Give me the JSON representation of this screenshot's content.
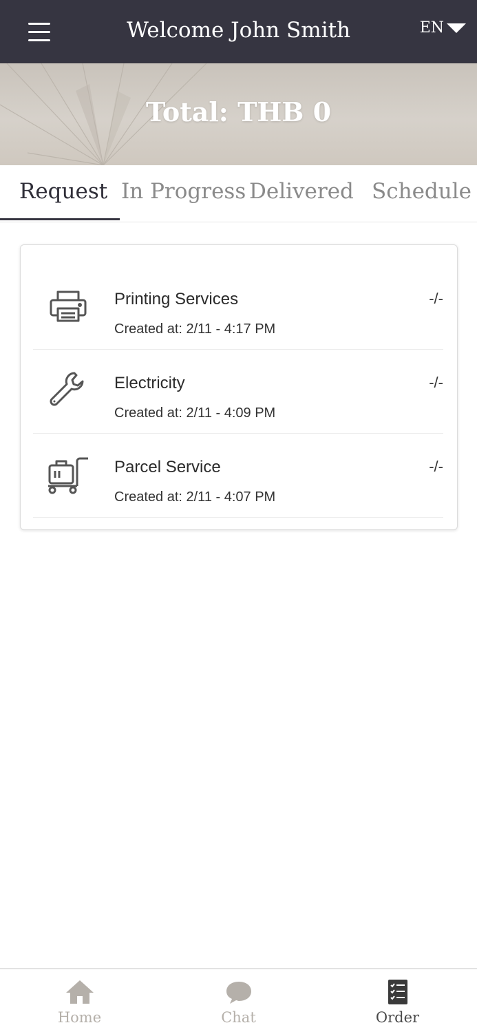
{
  "header": {
    "title": "Welcome John Smith",
    "language": "EN"
  },
  "banner": {
    "total": "Total: THB 0"
  },
  "tabs": [
    {
      "label": "Request",
      "active": true
    },
    {
      "label": "In Progress",
      "active": false
    },
    {
      "label": "Delivered",
      "active": false
    },
    {
      "label": "Schedule",
      "active": false
    }
  ],
  "requests": [
    {
      "icon": "printer-icon",
      "title": "Printing Services",
      "created": "Created at: 2/11 - 4:17 PM",
      "price": "-/-"
    },
    {
      "icon": "wrench-icon",
      "title": "Electricity",
      "created": "Created at: 2/11 - 4:09 PM",
      "price": "-/-"
    },
    {
      "icon": "luggage-cart-icon",
      "title": "Parcel Service",
      "created": "Created at: 2/11 - 4:07 PM",
      "price": "-/-"
    }
  ],
  "bottom_nav": [
    {
      "icon": "home-icon",
      "label": "Home",
      "active": false
    },
    {
      "icon": "chat-icon",
      "label": "Chat",
      "active": false
    },
    {
      "icon": "order-icon",
      "label": "Order",
      "active": true
    }
  ],
  "colors": {
    "header_bg": "#363541",
    "active_tab": "#2f2e38",
    "inactive_tab": "#8a8a8a",
    "nav_inactive": "#b5b0aa"
  }
}
